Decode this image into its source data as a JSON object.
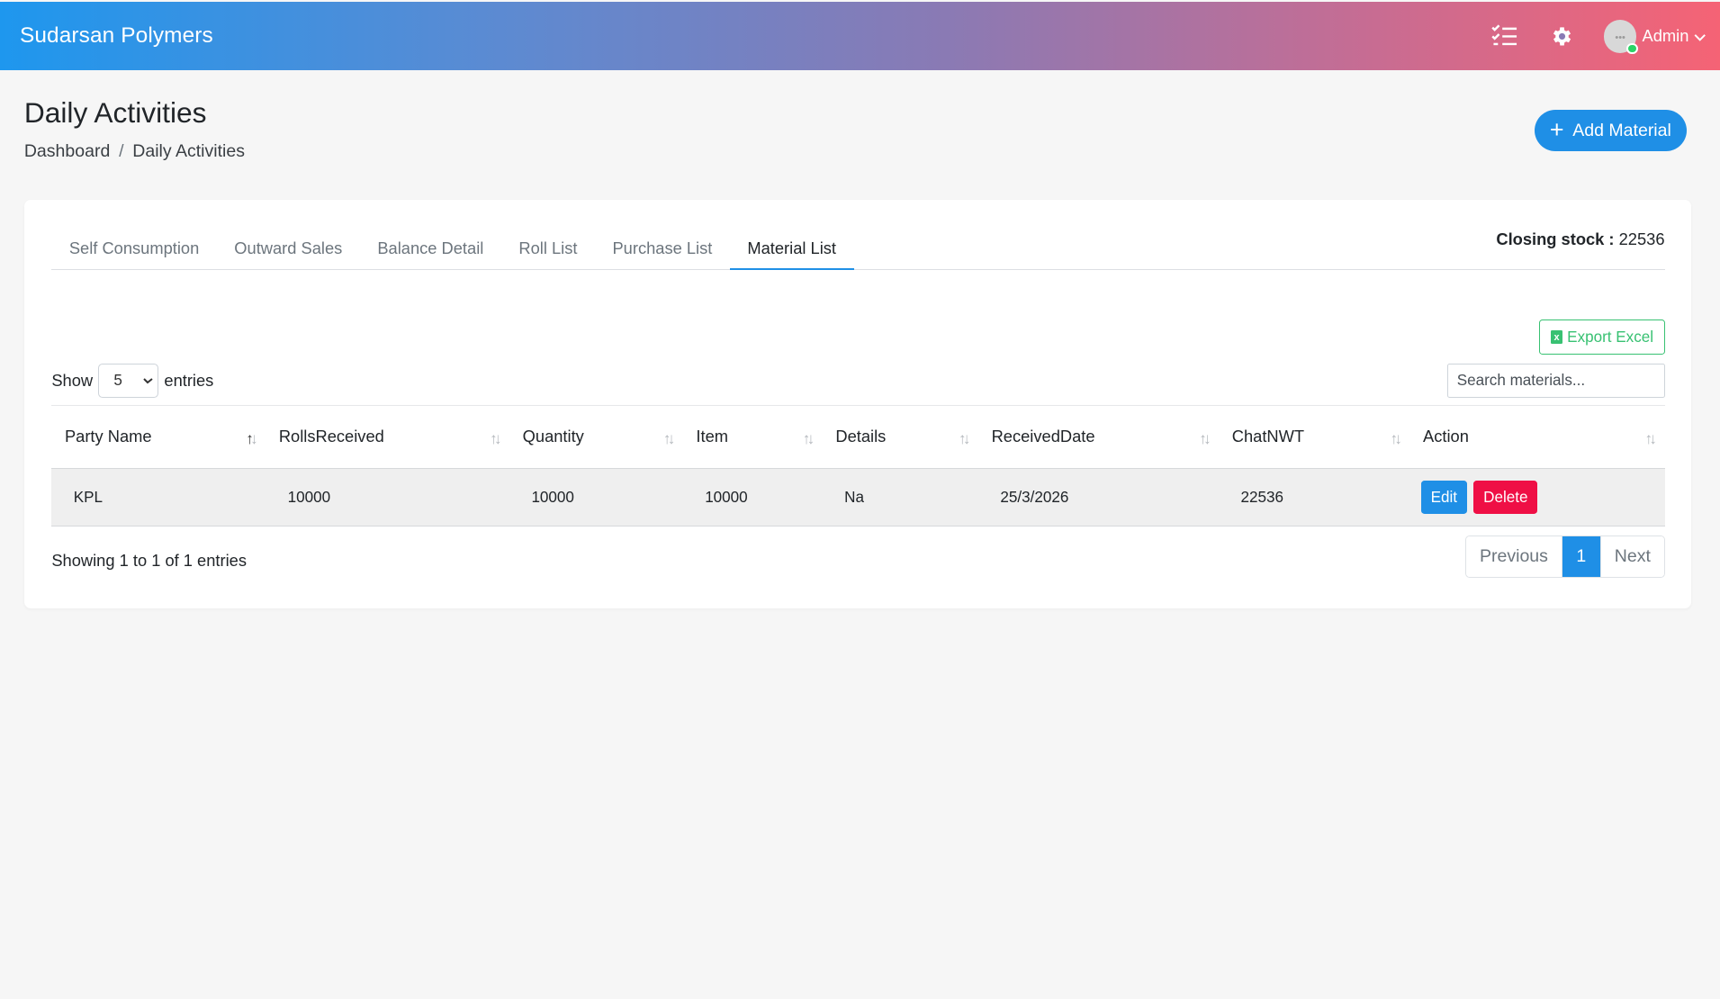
{
  "app": {
    "brand": "Sudarsan Polymers",
    "user_name": "Admin",
    "icons": [
      "checklist-icon",
      "gear-icon",
      "chevron-down-icon"
    ]
  },
  "header": {
    "title": "Daily Activities",
    "breadcrumb": [
      "Dashboard",
      "Daily Activities"
    ],
    "add_button": "Add Material"
  },
  "tabs": [
    {
      "label": "Self Consumption",
      "active": false
    },
    {
      "label": "Outward Sales",
      "active": false
    },
    {
      "label": "Balance Detail",
      "active": false
    },
    {
      "label": "Roll List",
      "active": false
    },
    {
      "label": "Purchase List",
      "active": false
    },
    {
      "label": "Material List",
      "active": true
    }
  ],
  "closing_stock": {
    "label": "Closing stock :",
    "value": "22536"
  },
  "export_label": "Export Excel",
  "length_menu": {
    "show": "Show",
    "selected": "5",
    "entries": "entries"
  },
  "search": {
    "placeholder": "Search materials..."
  },
  "table": {
    "columns": [
      "Party Name",
      "RollsReceived",
      "Quantity",
      "Item",
      "Details",
      "ReceivedDate",
      "ChatNWT",
      "Action"
    ],
    "rows": [
      {
        "party": "KPL",
        "rolls": "10000",
        "quantity": "10000",
        "item": "10000",
        "details": "Na",
        "date": "25/3/2026",
        "chatnwt": "22536",
        "edit": "Edit",
        "delete": "Delete"
      }
    ]
  },
  "footer": {
    "info": "Showing 1 to 1 of 1 entries",
    "prev": "Previous",
    "page": "1",
    "next": "Next"
  },
  "colors": {
    "accent": "#1f8fe6",
    "danger": "#ef0f45",
    "success": "#38c172"
  }
}
